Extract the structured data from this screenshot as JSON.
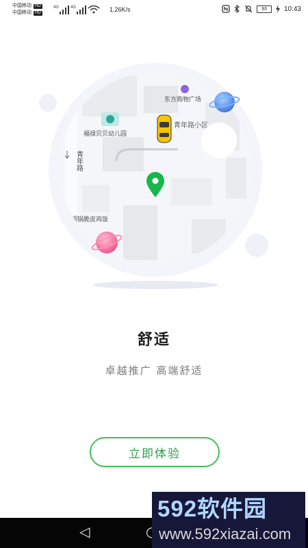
{
  "status_bar": {
    "carrier1": "中国移动",
    "carrier2": "中国移动",
    "hd": "HD",
    "signal1": "4G",
    "signal2": "4G",
    "speed": "1.26K/s",
    "battery": "93",
    "time": "10:43"
  },
  "map": {
    "labels": [
      "东方购物广场",
      "福禄贝贝幼儿园",
      "青年路小区",
      "青年路",
      "铜锅脆皮鸡饭"
    ]
  },
  "onboarding": {
    "title": "舒适",
    "subtitle": "卓越推广  高端舒适",
    "cta": "立即体验"
  },
  "watermark": {
    "line1": "592软件园",
    "line2": "www.592xiazai.com"
  },
  "nav": {
    "back": "◁",
    "home": "○",
    "recent": "□"
  },
  "colors": {
    "accent": "#3fbe56",
    "pin": "#18b64c",
    "title": "#1d1d1d",
    "subtitle": "#7b7b7b"
  }
}
